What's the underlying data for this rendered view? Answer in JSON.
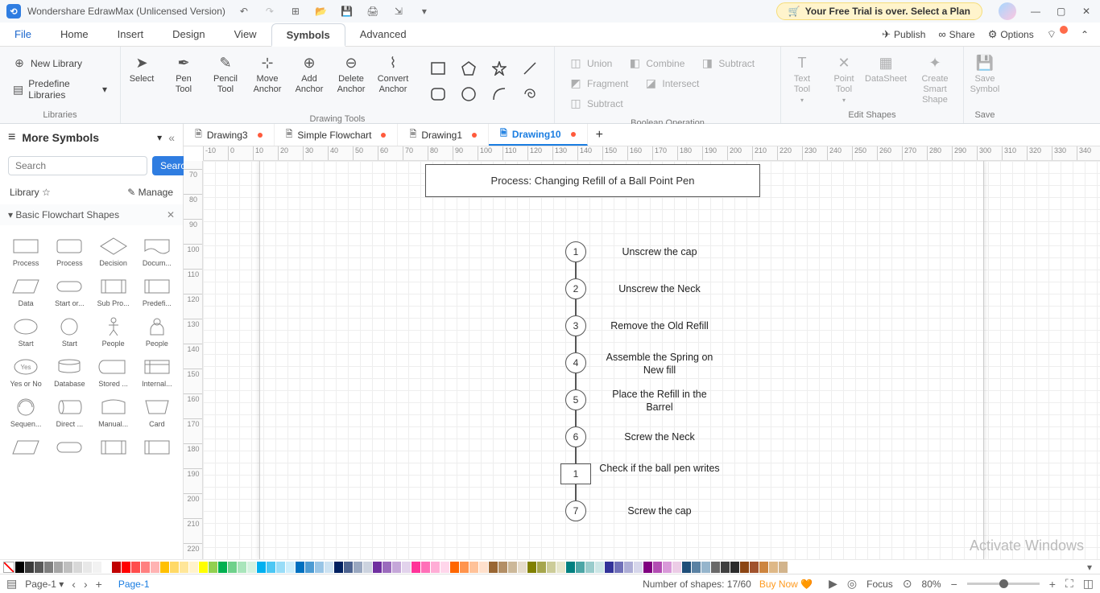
{
  "title_bar": {
    "app_name": "Wondershare EdrawMax (Unlicensed Version)",
    "trial_text": "Your Free Trial is over. Select a Plan"
  },
  "menu": {
    "file": "File",
    "home": "Home",
    "insert": "Insert",
    "design": "Design",
    "view": "View",
    "symbols": "Symbols",
    "advanced": "Advanced",
    "publish": "Publish",
    "share": "Share",
    "options": "Options"
  },
  "ribbon": {
    "group_libraries": "Libraries",
    "new_library": "New Library",
    "predefine_libraries": "Predefine Libraries",
    "group_drawing": "Drawing Tools",
    "select": "Select",
    "pen_tool": "Pen Tool",
    "pencil_tool": "Pencil Tool",
    "move_anchor": "Move Anchor",
    "add_anchor": "Add Anchor",
    "delete_anchor": "Delete Anchor",
    "convert_anchor": "Convert Anchor",
    "group_boolean": "Boolean Operation",
    "union": "Union",
    "combine": "Combine",
    "subtract": "Subtract",
    "fragment": "Fragment",
    "intersect": "Intersect",
    "subtract2": "Subtract",
    "group_edit": "Edit Shapes",
    "text_tool": "Text Tool",
    "point_tool": "Point Tool",
    "datasheet": "DataSheet",
    "smart_shape": "Create Smart Shape",
    "group_save": "Save",
    "save_symbol": "Save Symbol"
  },
  "sidebar": {
    "title": "More Symbols",
    "search_placeholder": "Search",
    "search_btn": "Search",
    "library_label": "Library",
    "manage_label": "Manage",
    "category": "Basic Flowchart Shapes",
    "shapes": [
      "Process",
      "Process",
      "Decision",
      "Docum...",
      "Data",
      "Start or...",
      "Sub Pro...",
      "Predefi...",
      "Start",
      "Start",
      "People",
      "People",
      "Yes or No",
      "Database",
      "Stored ...",
      "Internal...",
      "Sequen...",
      "Direct ...",
      "Manual...",
      "Card"
    ]
  },
  "tabs": {
    "items": [
      {
        "name": "Drawing3",
        "modified": true,
        "active": false
      },
      {
        "name": "Simple Flowchart",
        "modified": true,
        "active": false
      },
      {
        "name": "Drawing1",
        "modified": true,
        "active": false
      },
      {
        "name": "Drawing10",
        "modified": true,
        "active": true
      }
    ]
  },
  "canvas": {
    "title_box": "Process: Changing Refill of a Ball Point Pen",
    "steps": [
      {
        "n": "1",
        "shape": "circle",
        "text": "Unscrew the cap"
      },
      {
        "n": "2",
        "shape": "circle",
        "text": "Unscrew the Neck"
      },
      {
        "n": "3",
        "shape": "circle",
        "text": "Remove the Old Refill"
      },
      {
        "n": "4",
        "shape": "circle",
        "text": "Assemble the Spring on New fill"
      },
      {
        "n": "5",
        "shape": "circle",
        "text": "Place the Refill in the Barrel"
      },
      {
        "n": "6",
        "shape": "circle",
        "text": "Screw the Neck"
      },
      {
        "n": "1",
        "shape": "square",
        "text": "Check if the ball pen writes"
      },
      {
        "n": "7",
        "shape": "circle",
        "text": "Screw the cap"
      }
    ],
    "watermark": "Activate Windows"
  },
  "ruler": {
    "h": [
      "-10",
      "0",
      "10",
      "20",
      "30",
      "40",
      "50",
      "60",
      "70",
      "80",
      "90",
      "100",
      "110",
      "120",
      "130",
      "140",
      "150",
      "160",
      "170",
      "180",
      "190",
      "200",
      "210",
      "220",
      "230",
      "240",
      "250",
      "260",
      "270",
      "280",
      "290",
      "300",
      "310",
      "320",
      "330",
      "340"
    ],
    "v": [
      "70",
      "80",
      "90",
      "100",
      "110",
      "120",
      "130",
      "140",
      "150",
      "160",
      "170",
      "180",
      "190",
      "200",
      "210",
      "220"
    ]
  },
  "colorbar": [
    "#000000",
    "#3b3b3b",
    "#595959",
    "#7f7f7f",
    "#a5a5a5",
    "#bfbfbf",
    "#d8d8d8",
    "#e8e8e8",
    "#f2f2f2",
    "#ffffff",
    "#c00000",
    "#ff0000",
    "#ff4d4d",
    "#ff8080",
    "#ffb3b3",
    "#ffc000",
    "#ffd966",
    "#ffe699",
    "#fff2cc",
    "#ffff00",
    "#92d050",
    "#00b050",
    "#6fd18b",
    "#a9e5bb",
    "#d5f2e0",
    "#00b0f0",
    "#4cc7f4",
    "#99ddf8",
    "#cceefc",
    "#0070c0",
    "#4d9bd3",
    "#99c5e6",
    "#cce2f2",
    "#002060",
    "#4d6390",
    "#99a7c0",
    "#ccd3df",
    "#7030a0",
    "#9b6bbd",
    "#c5a7d9",
    "#e2d3ec",
    "#ff3399",
    "#ff70b8",
    "#ffadd6",
    "#ffd6eb",
    "#ff6600",
    "#ff944d",
    "#ffc299",
    "#ffe0cc",
    "#996633",
    "#b38f66",
    "#ccb899",
    "#e6dccc",
    "#808000",
    "#a6a64d",
    "#cccc99",
    "#e6e6cc",
    "#008080",
    "#4da6a6",
    "#99cccc",
    "#cce6e6",
    "#333399",
    "#7070b8",
    "#adadd6",
    "#d6d6eb",
    "#800080",
    "#b34db3",
    "#d999d9",
    "#eccce6",
    "#1f4e79",
    "#5b82a3",
    "#96b5cc",
    "#696969",
    "#404040",
    "#2c2c2c",
    "#8b4513",
    "#a0522d",
    "#cd853f",
    "#deb887",
    "#d2b48c"
  ],
  "statusbar": {
    "page_dropdown": "Page-1",
    "page_label": "Page-1",
    "shapes_count": "Number of shapes: 17/60",
    "buy_now": "Buy Now",
    "focus": "Focus",
    "zoom": "80%"
  }
}
